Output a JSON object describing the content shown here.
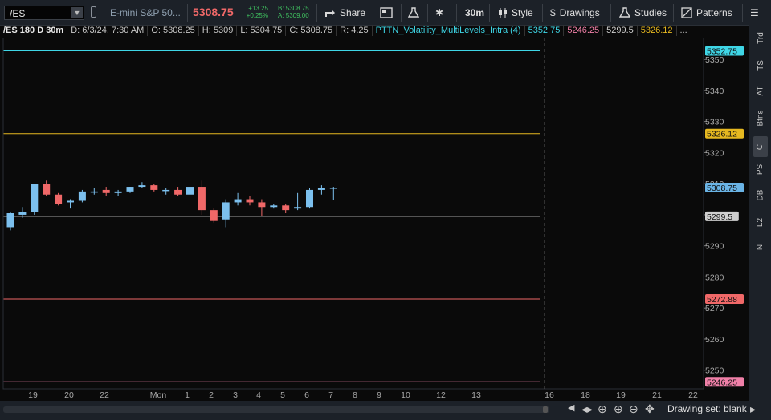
{
  "toolbar": {
    "symbol": "/ES",
    "description": "E-mini S&P 50...",
    "last_price": "5308.75",
    "change": "+13.25",
    "change_pct": "+0.25%",
    "bid": "B: 5308.75",
    "ask": "A: 5309.00",
    "share_label": "Share",
    "interval_label": "30m",
    "style_label": "Style",
    "drawings_label": "Drawings",
    "studies_label": "Studies",
    "patterns_label": "Patterns",
    "colors": {
      "down": "#f06868",
      "up": "#3fbf5f"
    }
  },
  "infobar": {
    "title": "/ES 180 D 30m",
    "date": "D: 6/3/24, 7:30 AM",
    "open": "O: 5308.25",
    "high": "H: 5309",
    "low": "L: 5304.75",
    "close": "C: 5308.75",
    "range": "R: 4.25",
    "study": "PTTN_Volatility_MultiLevels_Intra (4)",
    "level1": "5352.75",
    "level2": "5246.25",
    "level3": "5299.5",
    "level4": "5326.12",
    "more": "..."
  },
  "right_panel": {
    "tabs": [
      "Trd",
      "TS",
      "AT",
      "Btns",
      "C",
      "PS",
      "DB",
      "L2",
      "N"
    ],
    "active_tab": "C"
  },
  "bottom": {
    "drawing_set": "Drawing set: blank"
  },
  "chart_data": {
    "type": "candlestick",
    "ylim": [
      5244,
      5357
    ],
    "y_ticks": [
      5250,
      5260,
      5270,
      5280,
      5290,
      5300,
      5310,
      5320,
      5330,
      5340,
      5350
    ],
    "x_tick_labels": [
      "19",
      "20",
      "22",
      "Mon",
      "1",
      "2",
      "3",
      "4",
      "5",
      "6",
      "7",
      "8",
      "9",
      "10",
      "12",
      "13",
      "16",
      "18",
      "19",
      "21",
      "22"
    ],
    "levels": [
      {
        "value": 5352.75,
        "label": "5352.75",
        "color": "#3fd6e6"
      },
      {
        "value": 5326.12,
        "label": "5326.12",
        "color": "#e6b820"
      },
      {
        "value": 5299.5,
        "label": "5299.5",
        "color": "#cfcfcf"
      },
      {
        "value": 5272.88,
        "label": "5272.88",
        "color": "#f06868"
      },
      {
        "value": 5246.25,
        "label": "5246.25",
        "color": "#f080a8"
      }
    ],
    "last_price_tag": {
      "value": 5308.75,
      "label": "5308.75",
      "color": "#6ab4e6"
    },
    "candles": [
      {
        "o": 5296,
        "h": 5301,
        "l": 5295,
        "c": 5300.5
      },
      {
        "o": 5300,
        "h": 5302.5,
        "l": 5299,
        "c": 5301
      },
      {
        "o": 5301,
        "h": 5310,
        "l": 5300,
        "c": 5310
      },
      {
        "o": 5310,
        "h": 5311,
        "l": 5306,
        "c": 5306.5
      },
      {
        "o": 5306.5,
        "h": 5307,
        "l": 5303,
        "c": 5303.5
      },
      {
        "o": 5304,
        "h": 5305,
        "l": 5302,
        "c": 5304.5
      },
      {
        "o": 5304.5,
        "h": 5308,
        "l": 5304,
        "c": 5307.5
      },
      {
        "o": 5307.5,
        "h": 5308.5,
        "l": 5306.5,
        "c": 5307.5
      },
      {
        "o": 5308,
        "h": 5309,
        "l": 5306,
        "c": 5307
      },
      {
        "o": 5307,
        "h": 5308,
        "l": 5306,
        "c": 5307.5
      },
      {
        "o": 5307.5,
        "h": 5309,
        "l": 5307,
        "c": 5309
      },
      {
        "o": 5309,
        "h": 5310.5,
        "l": 5308.5,
        "c": 5309.5
      },
      {
        "o": 5309.5,
        "h": 5310,
        "l": 5307.5,
        "c": 5308
      },
      {
        "o": 5308,
        "h": 5308.5,
        "l": 5306.5,
        "c": 5308
      },
      {
        "o": 5308,
        "h": 5309,
        "l": 5306,
        "c": 5306.5
      },
      {
        "o": 5306.5,
        "h": 5312.5,
        "l": 5306,
        "c": 5309
      },
      {
        "o": 5309,
        "h": 5311,
        "l": 5300,
        "c": 5301.5
      },
      {
        "o": 5301.5,
        "h": 5302,
        "l": 5297.5,
        "c": 5298
      },
      {
        "o": 5298.5,
        "h": 5305,
        "l": 5296,
        "c": 5304
      },
      {
        "o": 5304,
        "h": 5307,
        "l": 5303,
        "c": 5305
      },
      {
        "o": 5305,
        "h": 5306,
        "l": 5303,
        "c": 5304
      },
      {
        "o": 5304,
        "h": 5305,
        "l": 5299.5,
        "c": 5302.5
      },
      {
        "o": 5302.5,
        "h": 5303.5,
        "l": 5302,
        "c": 5303
      },
      {
        "o": 5303,
        "h": 5303.5,
        "l": 5300.5,
        "c": 5301.5
      },
      {
        "o": 5302,
        "h": 5307,
        "l": 5301.5,
        "c": 5302.5
      },
      {
        "o": 5302.5,
        "h": 5308.5,
        "l": 5302,
        "c": 5308
      },
      {
        "o": 5308,
        "h": 5309.5,
        "l": 5306.5,
        "c": 5308.5
      },
      {
        "o": 5308.5,
        "h": 5309,
        "l": 5304.75,
        "c": 5308.75
      }
    ]
  }
}
